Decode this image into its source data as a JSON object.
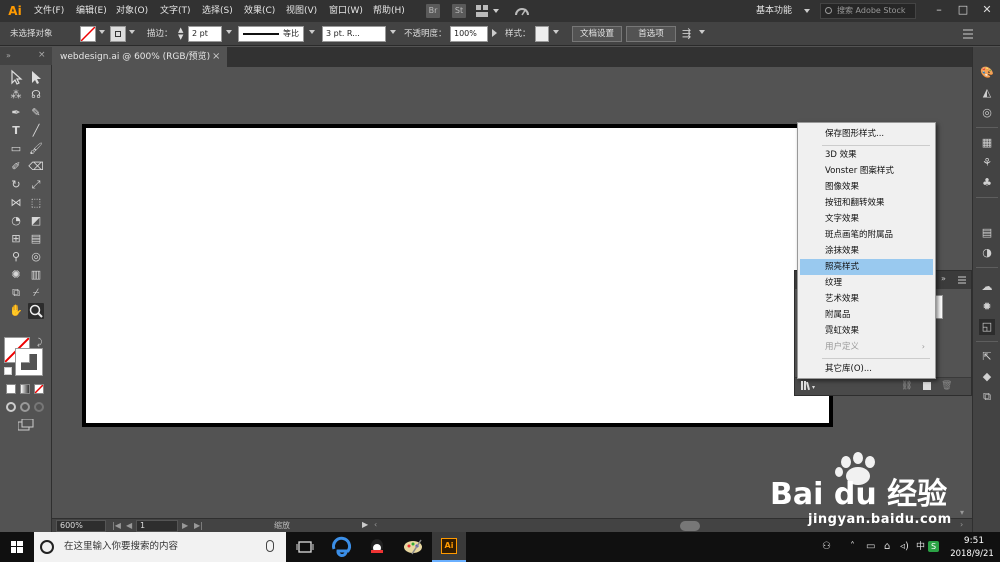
{
  "menubar": {
    "app_logo": "Ai",
    "items": [
      "文件(F)",
      "编辑(E)",
      "对象(O)",
      "文字(T)",
      "选择(S)",
      "效果(C)",
      "视图(V)",
      "窗口(W)",
      "帮助(H)"
    ],
    "icons": {
      "bridge": "Br",
      "stock": "St"
    },
    "workspace_label": "基本功能",
    "stock_search_placeholder": "搜索 Adobe Stock"
  },
  "controlbar": {
    "selection_label": "未选择对象",
    "stroke_label": "描边：",
    "stroke_value": "2 pt",
    "profile_label": "等比",
    "brush_value": "3 pt. R...",
    "opacity_label": "不透明度：",
    "opacity_value": "100%",
    "style_label": "样式：",
    "doc_setup_button": "文档设置",
    "preferences_button": "首选项"
  },
  "document_tab": {
    "title": "webdesign.ai @ 600% (RGB/预览)",
    "close": "×"
  },
  "context_menu": {
    "items": [
      {
        "label": "保存图形样式...",
        "state": "normal"
      },
      {
        "label": "3D 效果",
        "state": "normal"
      },
      {
        "label": "Vonster 图案样式",
        "state": "normal"
      },
      {
        "label": "图像效果",
        "state": "normal"
      },
      {
        "label": "按钮和翻转效果",
        "state": "normal"
      },
      {
        "label": "文字效果",
        "state": "normal"
      },
      {
        "label": "斑点画笔的附属品",
        "state": "normal"
      },
      {
        "label": "涂抹效果",
        "state": "normal"
      },
      {
        "label": "照亮样式",
        "state": "highlighted"
      },
      {
        "label": "纹理",
        "state": "normal"
      },
      {
        "label": "艺术效果",
        "state": "normal"
      },
      {
        "label": "附属品",
        "state": "normal"
      },
      {
        "label": "霓虹效果",
        "state": "normal"
      },
      {
        "label": "用户定义",
        "state": "disabled"
      },
      {
        "label": "其它库(O)...",
        "state": "normal"
      }
    ],
    "highlight_color": "#99c9ef"
  },
  "statusbar": {
    "zoom": "600%",
    "artboard_number": "1",
    "tool_name": "缩放"
  },
  "taskbar": {
    "search_placeholder": "在这里输入你要搜索的内容",
    "time": "9:51",
    "date": "2018/9/21",
    "active_app": "Ai"
  },
  "watermark": {
    "brand": "Bai du 经验",
    "url": "jingyan.baidu.com"
  },
  "colors": {
    "app_orange": "#ff9a00",
    "panel_dark": "#323232",
    "panel_mid": "#434343",
    "workspace_bg": "#535353"
  }
}
